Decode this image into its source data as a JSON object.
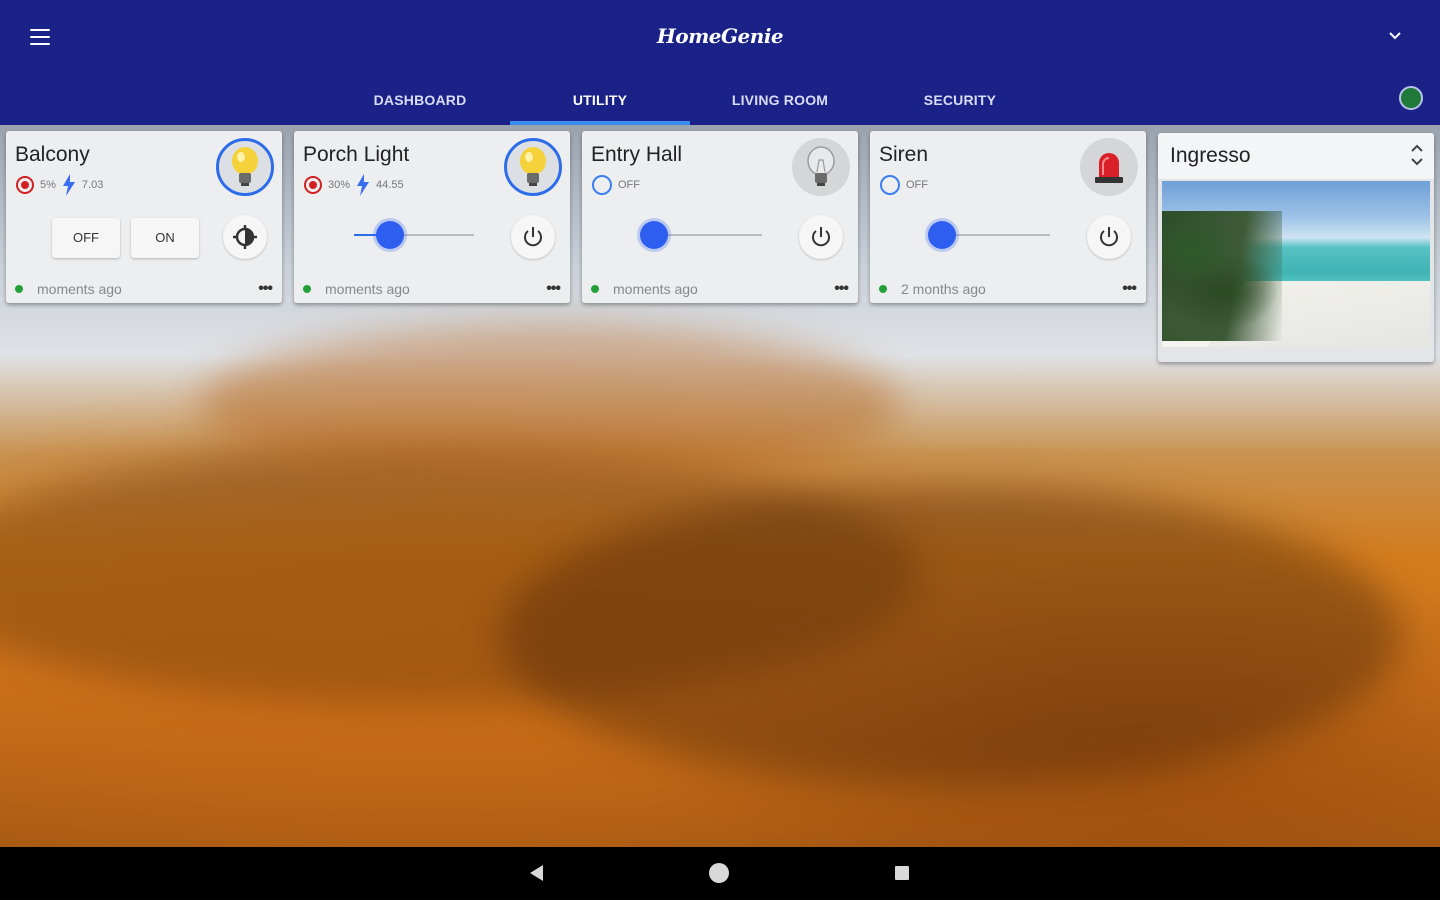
{
  "app": {
    "title": "HomeGenie"
  },
  "tabs": [
    {
      "label": "DASHBOARD"
    },
    {
      "label": "UTILITY"
    },
    {
      "label": "LIVING ROOM"
    },
    {
      "label": "SECURITY"
    }
  ],
  "cards": [
    {
      "title": "Balcony",
      "level": "5%",
      "watts": "7.03",
      "btn_off": "OFF",
      "btn_on": "ON",
      "updated": "moments ago",
      "icon": "lightbulb-on-icon"
    },
    {
      "title": "Porch Light",
      "level": "30%",
      "watts": "44.55",
      "updated": "moments ago",
      "slider_value": 0.3,
      "icon": "lightbulb-on-icon"
    },
    {
      "title": "Entry Hall",
      "status": "OFF",
      "updated": "moments ago",
      "slider_value": 0.1,
      "icon": "lightbulb-off-icon"
    },
    {
      "title": "Siren",
      "status": "OFF",
      "updated": "2 months ago",
      "slider_value": 0.1,
      "icon": "siren-icon"
    }
  ],
  "camera": {
    "title": "Ingresso"
  },
  "colors": {
    "appbar": "#1b2287",
    "accent": "#2d6ce8",
    "active_tab_indicator": "#3a8cf2",
    "record": "#d32020",
    "online": "#22a03a"
  }
}
